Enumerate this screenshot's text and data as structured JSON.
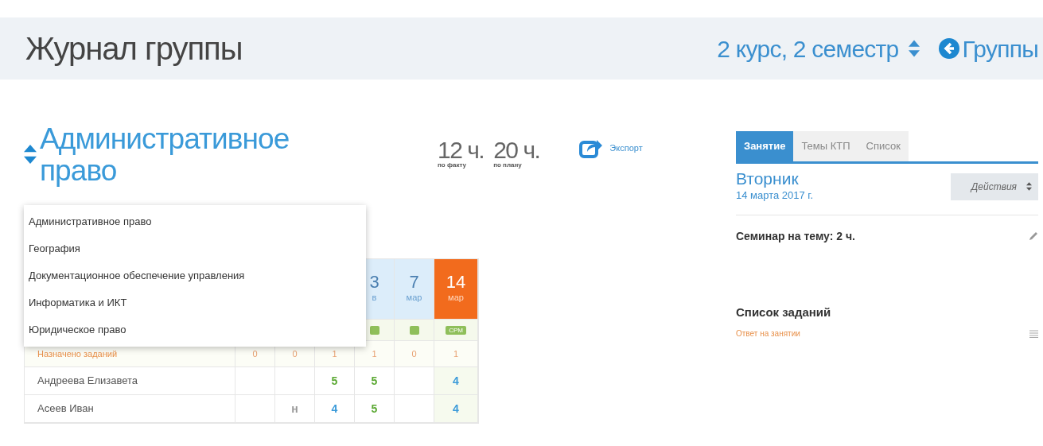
{
  "header": {
    "title": "Журнал группы",
    "period": "2 курс, 2 семестр",
    "back_link": "Группы"
  },
  "subject": {
    "title": "Административное право",
    "hours_fact": "12 ч.",
    "hours_fact_label": "по факту",
    "hours_plan": "20 ч.",
    "hours_plan_label": "по плану",
    "export": "Экспорт"
  },
  "subject_menu": {
    "items": [
      "Административное право",
      "География",
      "Документационное обеспечение управления",
      "Информатика и ИКТ",
      "Юридическое право"
    ]
  },
  "journal": {
    "columns": [
      {},
      {},
      {},
      {
        "day": "3",
        "month": "в",
        "selected": false,
        "has_badge": true
      },
      {
        "day": "7",
        "month": "мар",
        "selected": false,
        "has_badge": true
      },
      {
        "day": "14",
        "month": "мар",
        "selected": true,
        "badge": "СРМ"
      }
    ],
    "assigned": {
      "label": "Назначено заданий",
      "values": [
        "0",
        "0",
        "1",
        "1",
        "0",
        "1"
      ]
    },
    "students": [
      {
        "name": "Андреева Елизавета",
        "marks": [
          {
            "kind": "blank"
          },
          {
            "kind": "blank"
          },
          {
            "kind": "grade",
            "text": "5",
            "color": "#5aa832"
          },
          {
            "kind": "grade",
            "text": "5",
            "color": "#5aa832"
          },
          {
            "kind": "blank"
          },
          {
            "kind": "grade",
            "text": "4",
            "color": "#3a9ad9"
          }
        ]
      },
      {
        "name": "Асеев Иван",
        "marks": [
          {
            "kind": "blank"
          },
          {
            "kind": "grade",
            "text": "н",
            "color": "#999999"
          },
          {
            "kind": "grade",
            "text": "4",
            "color": "#3a9ad9"
          },
          {
            "kind": "grade",
            "text": "5",
            "color": "#5aa832"
          },
          {
            "kind": "blank"
          },
          {
            "kind": "grade",
            "text": "4",
            "color": "#3a9ad9"
          }
        ]
      }
    ]
  },
  "side_panel": {
    "tabs": [
      {
        "label": "Занятие",
        "selected": true
      },
      {
        "label": "Темы КТП",
        "selected": false
      },
      {
        "label": "Список",
        "selected": false
      }
    ],
    "weekday": "Вторник",
    "date": "14 марта 2017 г.",
    "actions": "Действия",
    "lesson": "Семинар на тему: 2 ч.",
    "tasks_title": "Список заданий",
    "tasks": [
      "Ответ на занятии"
    ]
  }
}
